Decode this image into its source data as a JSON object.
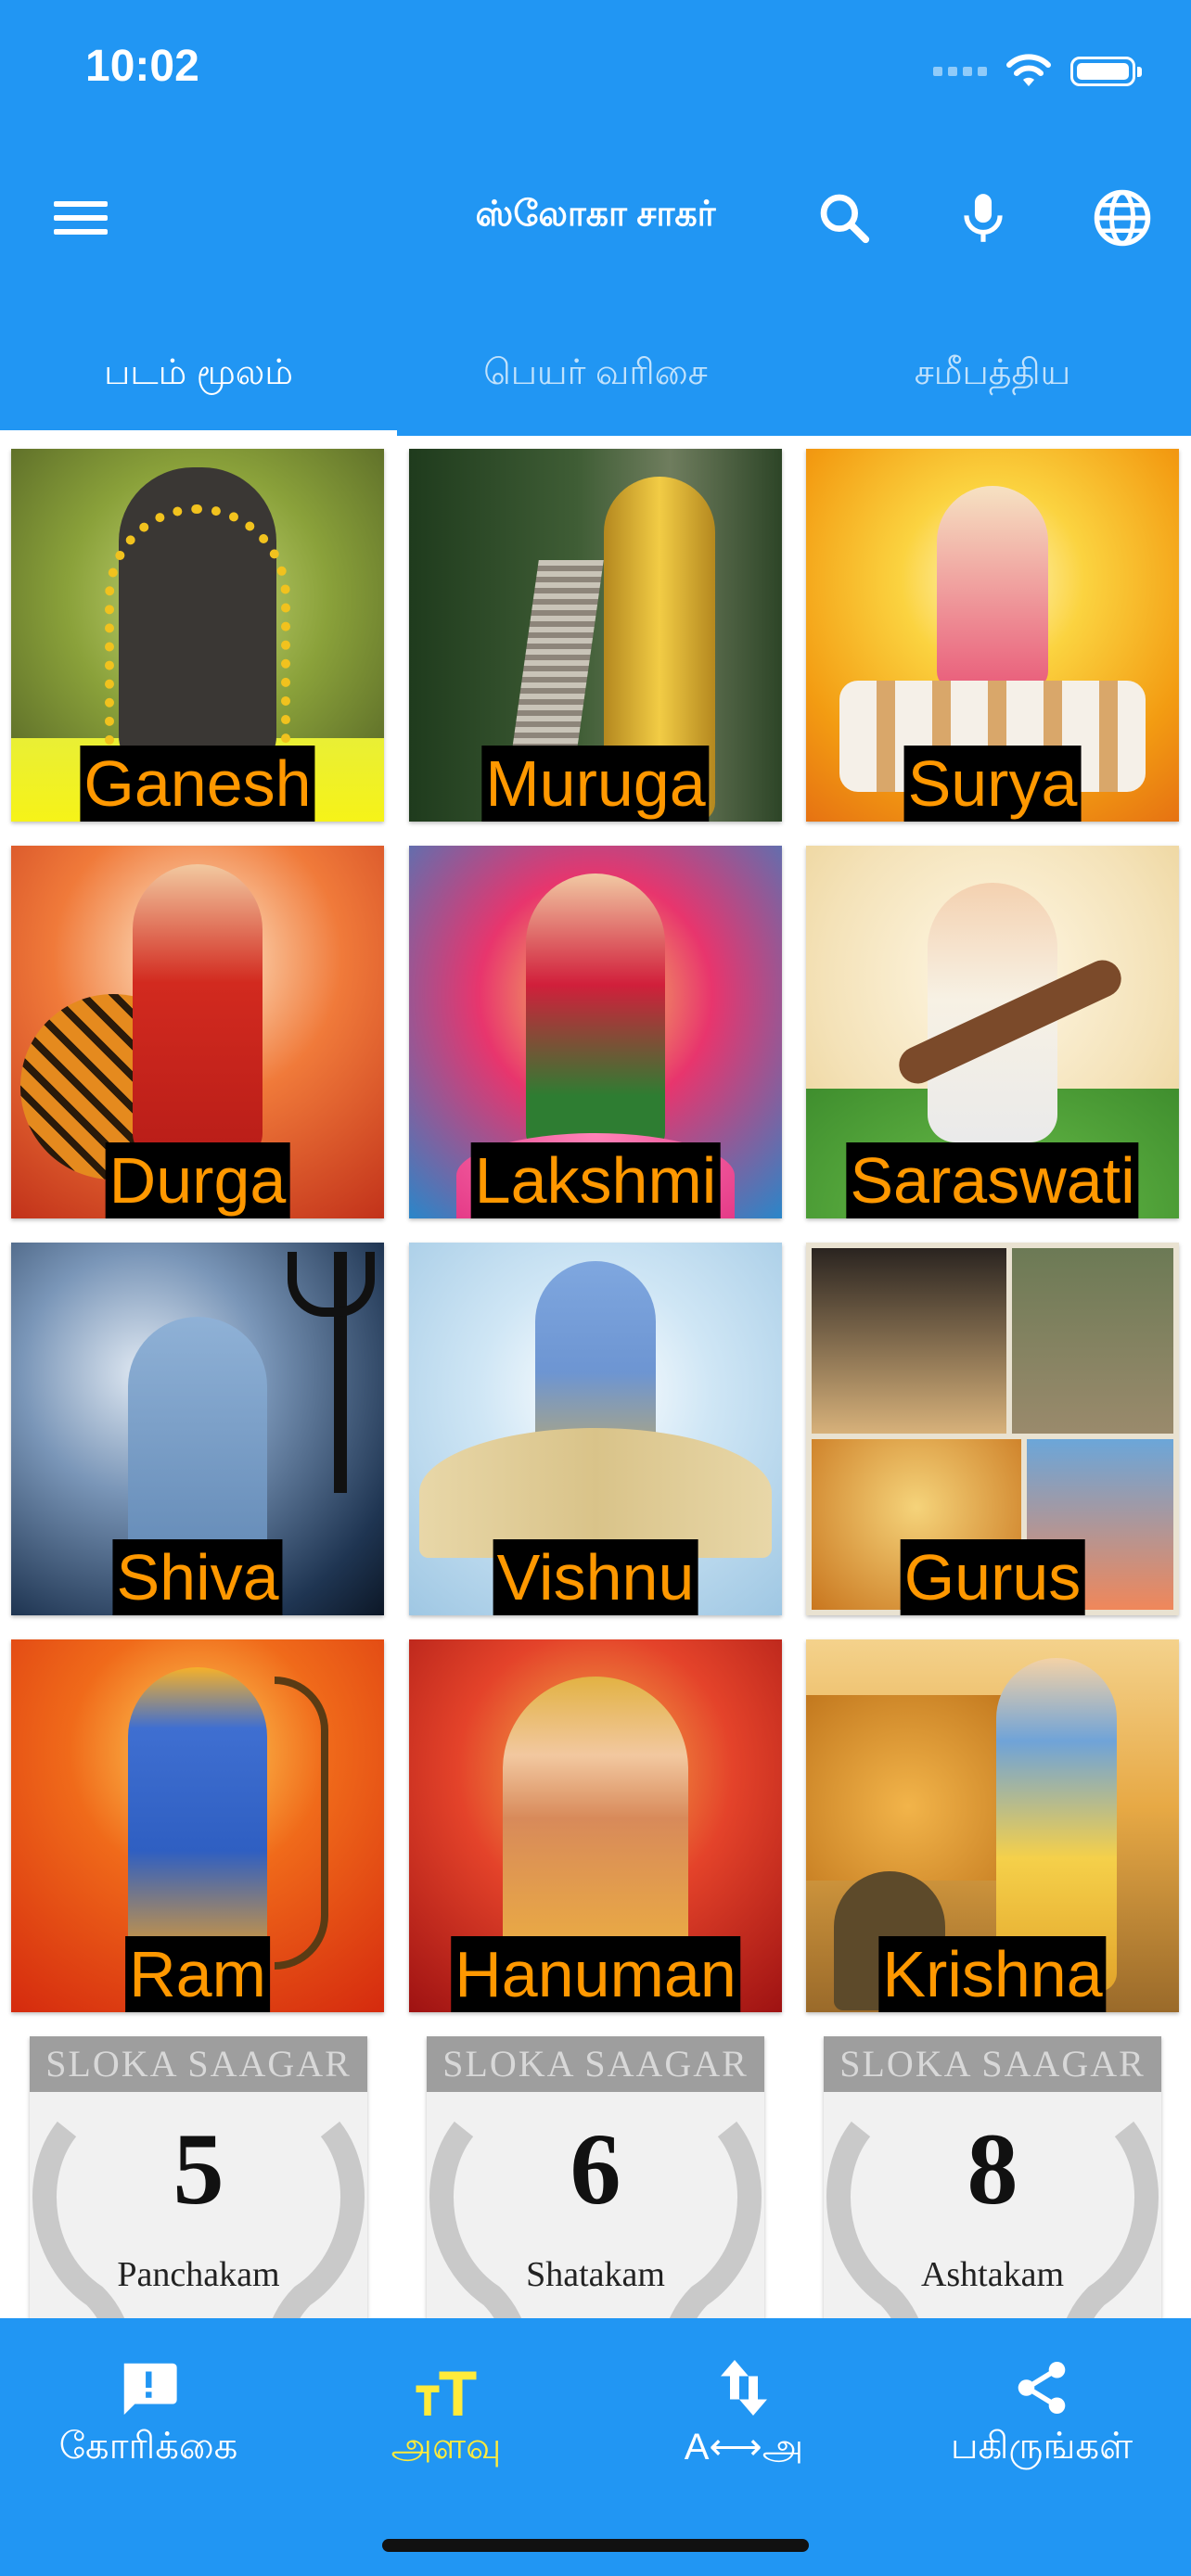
{
  "status_bar": {
    "time": "10:02"
  },
  "app_bar": {
    "title": "ஸ்லோகா சாகர்",
    "color": "#2196F3"
  },
  "tabs": [
    {
      "label": "படம் மூலம்",
      "active": true
    },
    {
      "label": "பெயர் வரிசை",
      "active": false
    },
    {
      "label": "சமீபத்திய",
      "active": false
    }
  ],
  "deities": [
    {
      "name": "Ganesh",
      "icon": "ganesh-image"
    },
    {
      "name": "Muruga",
      "icon": "muruga-image"
    },
    {
      "name": "Surya",
      "icon": "surya-image"
    },
    {
      "name": "Durga",
      "icon": "durga-image"
    },
    {
      "name": "Lakshmi",
      "icon": "lakshmi-image"
    },
    {
      "name": "Saraswati",
      "icon": "saraswati-image"
    },
    {
      "name": "Shiva",
      "icon": "shiva-image"
    },
    {
      "name": "Vishnu",
      "icon": "vishnu-image"
    },
    {
      "name": "Gurus",
      "icon": "gurus-image"
    },
    {
      "name": "Ram",
      "icon": "ram-image"
    },
    {
      "name": "Hanuman",
      "icon": "hanuman-image"
    },
    {
      "name": "Krishna",
      "icon": "krishna-image"
    }
  ],
  "sloka_cards": [
    {
      "header": "SLOKA SAAGAR",
      "number": "5",
      "name": "Panchakam"
    },
    {
      "header": "SLOKA SAAGAR",
      "number": "6",
      "name": "Shatakam"
    },
    {
      "header": "SLOKA SAAGAR",
      "number": "8",
      "name": "Ashtakam"
    }
  ],
  "bottom_nav": [
    {
      "label": "கோரிக்கை",
      "icon": "feedback-icon",
      "active": false
    },
    {
      "label": "அளவு",
      "icon": "text-size-icon",
      "active": true
    },
    {
      "label": "A⟷அ",
      "icon": "swap-vertical-icon",
      "active": false
    },
    {
      "label": "பகிருங்கள்",
      "icon": "share-icon",
      "active": false
    }
  ],
  "label_color": "#FF9800",
  "active_nav_color": "#FFEB3B"
}
